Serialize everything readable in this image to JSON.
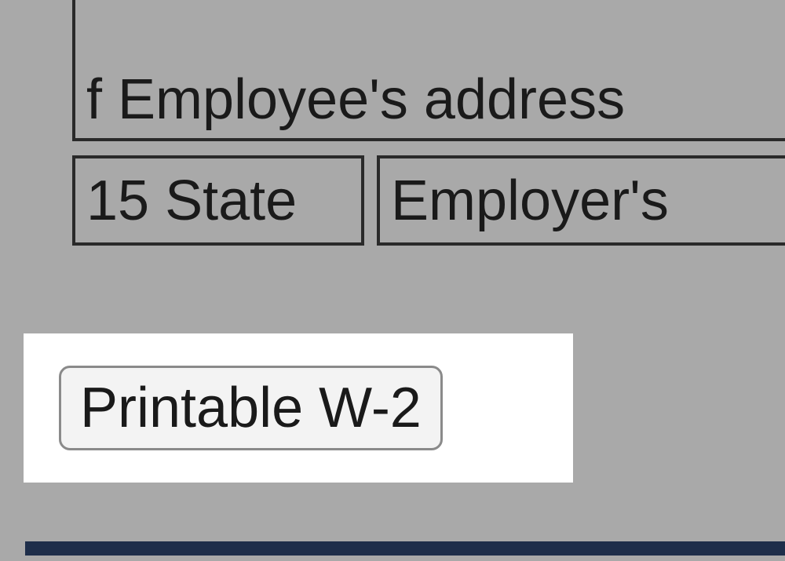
{
  "form": {
    "box_f_label": "f Employee's address",
    "box_15_label": "15 State",
    "box_employer_label": "Employer's"
  },
  "button": {
    "printable_label": "Printable W-2"
  }
}
